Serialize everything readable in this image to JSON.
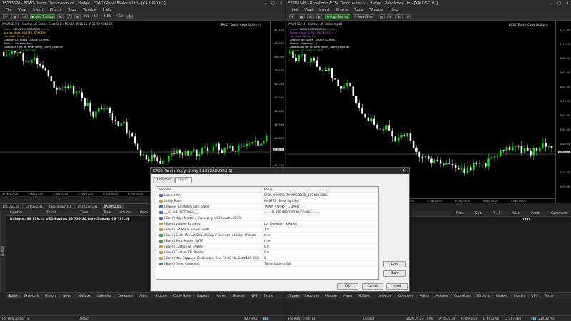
{
  "left": {
    "title": "15133670 - FTMO-Demo: Demo Account - Hedge - FTMO Global Markets Ltd - [XAUUSD,H1]",
    "menu": [
      "File",
      "View",
      "Insert",
      "Charts",
      "Tools",
      "Window",
      "Help"
    ],
    "algo": "Algo Trading",
    "timeframes": [
      "M1",
      "M5",
      "M15",
      "M30",
      "H1"
    ],
    "chart_title": "XAUUSD,H1 - Gold vs US Dollar, Spot CFD  4552.65  4546.55  4535.99  4550.55",
    "ea_label": "EA35_Tamin_Copy_Utility",
    "overlay": {
      "line1": "==== TAMIN EA35 EDITION ====",
      "line2": "Access Mode: MASTER (SENDER)",
      "line3": "Lot Mode: Fixed: 1.0",
      "line4": "Channel ID: TAMIN_CODER_123MHz",
      "line5": "Status: [ broadcasting... ]",
      "line6": "Download Free at: t.me/Tamin_Coder_Channel",
      "line7": "License: ACTIVE LIFETIME"
    },
    "prices": [
      "4721.00",
      "4699.60",
      "4680.60",
      "4661.60",
      "4642.60",
      "4623.60",
      "4604.60",
      "4585.60",
      "4566.00",
      "4548.03",
      "4527.60",
      "4510.60"
    ],
    "price_marker": "4548.03",
    "times": [
      "13 May 2026",
      "4 May 17:00",
      "5 May 07:00",
      "5 May 17:00",
      "6 May 03:00",
      "6 May 13:00",
      "6 May 23:00",
      "7 May 09:00",
      "7 May 19:00",
      "8 May 05:00"
    ],
    "chart_tabs": [
      "BTCUSD,H1",
      "EURUSD,H1",
      "GER40.cash,H1",
      "US30.cash,H1",
      "XAUUSD,H1"
    ],
    "columns": [
      "Symbol",
      "Ticket",
      "Time",
      "Type",
      "Volume",
      "Price"
    ],
    "balance": "Balance: 99 739.24 USD  Equity: 99 739.24  Free Margin: 99 739.24",
    "bottom_tabs": [
      "Trade",
      "Exposure",
      "History",
      "News",
      "Mailbox",
      "Calendar",
      "Company",
      "Alerts",
      "Articles",
      "Code Base",
      "Experts",
      "Market",
      "Signals",
      "VPS",
      "Tester"
    ],
    "toolbox": "Toolbox",
    "status_help": "For Help, press F1",
    "status_profile": "Default",
    "status_traffic": "42 / 3 kb"
  },
  "right": {
    "title": "51191549 - RoboForex-ECN: Demo Account - Hedge - RoboForex Ltd - [XAUUSD,H1]",
    "menu": [
      "File",
      "View",
      "Insert",
      "Charts",
      "Tools",
      "Window",
      "Help"
    ],
    "algo": "Algo Trading",
    "new_order": "New Order",
    "chart_title": "XAUUSD,H1 - Gold vs US Dollar (spot)",
    "ea_label": "EA35_Tamin_Copy_Utility",
    "overlay": {
      "line1": "==== TAMIN EA35 EDITION ====",
      "line2": "Access Mode: SLAVE (RECEIVER)",
      "line3": "Lot Mode: Ratio: 1.0",
      "line4": "Channel ID: TAMIN_CODER_123MHz",
      "line5": "Status: [ listening... ]",
      "line6": "Download Free at: t.me/Tamin_Coder_Channel",
      "line7": "License: ACTIVE LIFETIME"
    },
    "prices": [
      "4721.00",
      "4699.06",
      "4680.06",
      "4661.06",
      "4642.06",
      "4623.06",
      "4604.06",
      "4585.06",
      "4566.06",
      "4547.06",
      "4528.06",
      "4509.06"
    ],
    "price_marker": "4548.21",
    "times": [
      "6 May 2026",
      "7 May 00:00",
      "7 May 08:00",
      "7 May 16:00",
      "8 May 00:00",
      "8 May 08:00",
      "8 May 16:00",
      "9 May 00:00",
      "9 May 08:00"
    ],
    "columns": [
      "Price",
      "S / L",
      "T / P",
      "Price",
      "Profit",
      "Comment"
    ],
    "bottom_tabs": [
      "Trade",
      "Exposure",
      "History",
      "News",
      "Mailbox",
      "Calendar",
      "Company",
      "Alerts",
      "Articles",
      "Code Base",
      "Experts",
      "Market",
      "Signals",
      "VPS",
      "Tester"
    ],
    "status_help": "For Help, press F1",
    "status_profile": "Default",
    "status_time": "2026.05.13 17:00",
    "status_o": "O: 4679.34",
    "status_h": "H: 4691.04",
    "status_l": "L: 4672.90",
    "status_c": "C: 4676.86",
    "status_traffic": "230.33 ms"
  },
  "dialog": {
    "title": "EA35_Tamin_Copy_Utility 1.18 (XAUUSD,H1)",
    "tabs": [
      "Common",
      "Inputs"
    ],
    "header_variable": "Variable",
    "header_value": "Value",
    "rows": [
      {
        "name": "License Key",
        "value": "EA35_999990_TAMINCODER_60248840853",
        "icon": "ab"
      },
      {
        "name": "Utility Role",
        "value": "MASTER (Send Signals)",
        "icon": "num"
      },
      {
        "name": "Channel ID (Match both sides)",
        "value": "TAMIN_CODER_123MHz",
        "icon": "ab"
      },
      {
        "name": "___SLAVE_SETTINGS___",
        "value": "===SLAVE (RECEIVER) CONFIG ===",
        "icon": "ab"
      },
      {
        "name": "[Slave] Map: Master->Slave (e.g. US30.cash=US30)",
        "value": "",
        "icon": "ab"
      },
      {
        "name": "[Slave] Volume Strategy",
        "value": "Lot Multiplier (x Ratio)",
        "icon": "num"
      },
      {
        "name": "[Slave] Lot Value (Ratio/Fixed)",
        "value": "1.0",
        "icon": "num"
      },
      {
        "name": "[Slave] Strict Min Lot Shield (Skip if Calc.Lot < Broker MinLot)",
        "value": "true",
        "icon": "bool"
      },
      {
        "name": "[Slave] Sync Master SL/TP",
        "value": "true",
        "icon": "bool"
      },
      {
        "name": "[Slave] Custom SL (Points)",
        "value": "0.0",
        "icon": "num"
      },
      {
        "name": "[Slave] Custom TP (Points)",
        "value": "0.0",
        "icon": "num"
      },
      {
        "name": "[Slave] Max Slippage (0=Disable, Rec: FX:30-50, Gold:100-300)",
        "value": "0",
        "icon": "num"
      },
      {
        "name": "[Slave] Order Comment",
        "value": "Tamin Coder's Gift",
        "icon": "ab"
      }
    ],
    "load": "Load",
    "save": "Save",
    "ok": "OK",
    "cancel": "Cancel",
    "reset": "Reset"
  },
  "colors": {
    "bull": "#00e600",
    "bear": "#ffffff",
    "master_text": "#ffd700",
    "slave_text": "#cc55ff",
    "license": "#32cd32"
  }
}
